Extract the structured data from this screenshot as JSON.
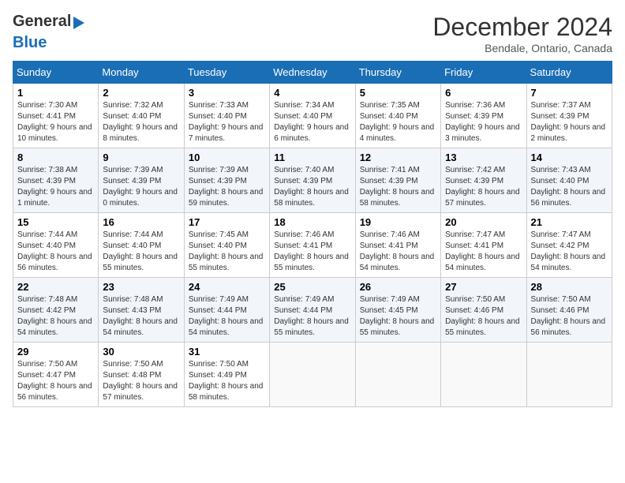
{
  "logo": {
    "line1": "General",
    "line2": "Blue"
  },
  "title": "December 2024",
  "location": "Bendale, Ontario, Canada",
  "weekdays": [
    "Sunday",
    "Monday",
    "Tuesday",
    "Wednesday",
    "Thursday",
    "Friday",
    "Saturday"
  ],
  "weeks": [
    [
      {
        "day": "1",
        "info": "Sunrise: 7:30 AM\nSunset: 4:41 PM\nDaylight: 9 hours and 10 minutes."
      },
      {
        "day": "2",
        "info": "Sunrise: 7:32 AM\nSunset: 4:40 PM\nDaylight: 9 hours and 8 minutes."
      },
      {
        "day": "3",
        "info": "Sunrise: 7:33 AM\nSunset: 4:40 PM\nDaylight: 9 hours and 7 minutes."
      },
      {
        "day": "4",
        "info": "Sunrise: 7:34 AM\nSunset: 4:40 PM\nDaylight: 9 hours and 6 minutes."
      },
      {
        "day": "5",
        "info": "Sunrise: 7:35 AM\nSunset: 4:40 PM\nDaylight: 9 hours and 4 minutes."
      },
      {
        "day": "6",
        "info": "Sunrise: 7:36 AM\nSunset: 4:39 PM\nDaylight: 9 hours and 3 minutes."
      },
      {
        "day": "7",
        "info": "Sunrise: 7:37 AM\nSunset: 4:39 PM\nDaylight: 9 hours and 2 minutes."
      }
    ],
    [
      {
        "day": "8",
        "info": "Sunrise: 7:38 AM\nSunset: 4:39 PM\nDaylight: 9 hours and 1 minute."
      },
      {
        "day": "9",
        "info": "Sunrise: 7:39 AM\nSunset: 4:39 PM\nDaylight: 9 hours and 0 minutes."
      },
      {
        "day": "10",
        "info": "Sunrise: 7:39 AM\nSunset: 4:39 PM\nDaylight: 8 hours and 59 minutes."
      },
      {
        "day": "11",
        "info": "Sunrise: 7:40 AM\nSunset: 4:39 PM\nDaylight: 8 hours and 58 minutes."
      },
      {
        "day": "12",
        "info": "Sunrise: 7:41 AM\nSunset: 4:39 PM\nDaylight: 8 hours and 58 minutes."
      },
      {
        "day": "13",
        "info": "Sunrise: 7:42 AM\nSunset: 4:39 PM\nDaylight: 8 hours and 57 minutes."
      },
      {
        "day": "14",
        "info": "Sunrise: 7:43 AM\nSunset: 4:40 PM\nDaylight: 8 hours and 56 minutes."
      }
    ],
    [
      {
        "day": "15",
        "info": "Sunrise: 7:44 AM\nSunset: 4:40 PM\nDaylight: 8 hours and 56 minutes."
      },
      {
        "day": "16",
        "info": "Sunrise: 7:44 AM\nSunset: 4:40 PM\nDaylight: 8 hours and 55 minutes."
      },
      {
        "day": "17",
        "info": "Sunrise: 7:45 AM\nSunset: 4:40 PM\nDaylight: 8 hours and 55 minutes."
      },
      {
        "day": "18",
        "info": "Sunrise: 7:46 AM\nSunset: 4:41 PM\nDaylight: 8 hours and 55 minutes."
      },
      {
        "day": "19",
        "info": "Sunrise: 7:46 AM\nSunset: 4:41 PM\nDaylight: 8 hours and 54 minutes."
      },
      {
        "day": "20",
        "info": "Sunrise: 7:47 AM\nSunset: 4:41 PM\nDaylight: 8 hours and 54 minutes."
      },
      {
        "day": "21",
        "info": "Sunrise: 7:47 AM\nSunset: 4:42 PM\nDaylight: 8 hours and 54 minutes."
      }
    ],
    [
      {
        "day": "22",
        "info": "Sunrise: 7:48 AM\nSunset: 4:42 PM\nDaylight: 8 hours and 54 minutes."
      },
      {
        "day": "23",
        "info": "Sunrise: 7:48 AM\nSunset: 4:43 PM\nDaylight: 8 hours and 54 minutes."
      },
      {
        "day": "24",
        "info": "Sunrise: 7:49 AM\nSunset: 4:44 PM\nDaylight: 8 hours and 54 minutes."
      },
      {
        "day": "25",
        "info": "Sunrise: 7:49 AM\nSunset: 4:44 PM\nDaylight: 8 hours and 55 minutes."
      },
      {
        "day": "26",
        "info": "Sunrise: 7:49 AM\nSunset: 4:45 PM\nDaylight: 8 hours and 55 minutes."
      },
      {
        "day": "27",
        "info": "Sunrise: 7:50 AM\nSunset: 4:46 PM\nDaylight: 8 hours and 55 minutes."
      },
      {
        "day": "28",
        "info": "Sunrise: 7:50 AM\nSunset: 4:46 PM\nDaylight: 8 hours and 56 minutes."
      }
    ],
    [
      {
        "day": "29",
        "info": "Sunrise: 7:50 AM\nSunset: 4:47 PM\nDaylight: 8 hours and 56 minutes."
      },
      {
        "day": "30",
        "info": "Sunrise: 7:50 AM\nSunset: 4:48 PM\nDaylight: 8 hours and 57 minutes."
      },
      {
        "day": "31",
        "info": "Sunrise: 7:50 AM\nSunset: 4:49 PM\nDaylight: 8 hours and 58 minutes."
      },
      null,
      null,
      null,
      null
    ]
  ]
}
